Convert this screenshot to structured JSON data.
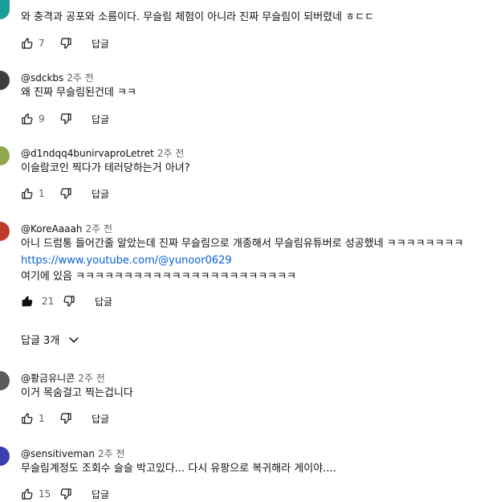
{
  "comments": [
    {
      "handle": "",
      "time": "",
      "text": "와 충격과 공포와 소름이다. 무슬림 체험이 아니라 진짜 무슬림이 되버렸네 ㅎㄷㄷ",
      "likes": "7",
      "reply_label": "답글",
      "avatar_color": "#1a9e9b"
    },
    {
      "handle": "@sdckbs",
      "time": "2주 전",
      "text": "왜 진짜 무슬림된건데 ㅋㅋ",
      "likes": "9",
      "reply_label": "답글",
      "avatar_color": "#3c3c3c"
    },
    {
      "handle": "@d1ndqq4bunirvaproLetret",
      "time": "2주 전",
      "text": "이슬람코인 찍다가 테러당하는거 아녀?",
      "likes": "1",
      "reply_label": "답글",
      "avatar_color": "#8fa84b"
    },
    {
      "handle": "@KoreAaaah",
      "time": "2주 전",
      "text_line1": "아니 드럼통 들어간줄 알았는데 진짜 무슬림으로 개종해서 무슬림유튜버로 성공했네 ㅋㅋㅋㅋㅋㅋㅋㅋ",
      "link": "https://www.youtube.com/@yunoor0629",
      "text_line3": "여기에 있음 ㅋㅋㅋㅋㅋㅋㅋㅋㅋㅋㅋㅋㅋㅋㅋㅋㅋㅋㅋㅋㅋㅋㅋ",
      "likes": "21",
      "reply_label": "답글",
      "avatar_color": "#c0392b"
    },
    {
      "handle": "@황금유니콘",
      "time": "2주 전",
      "text": "이거 목숨걸고 찍는겁니다",
      "likes": "1",
      "reply_label": "답글",
      "avatar_color": "#5a5a5a"
    },
    {
      "handle": "@sensitiveman",
      "time": "2주 전",
      "text": "무슬림계정도 조회수 슬슬 박고있다... 다시 유팡으로 복귀해라 게이야....",
      "likes": "15",
      "reply_label": "답글",
      "avatar_color": "#3b3fb0"
    }
  ],
  "replies_toggle": {
    "label": "답글 3개"
  }
}
